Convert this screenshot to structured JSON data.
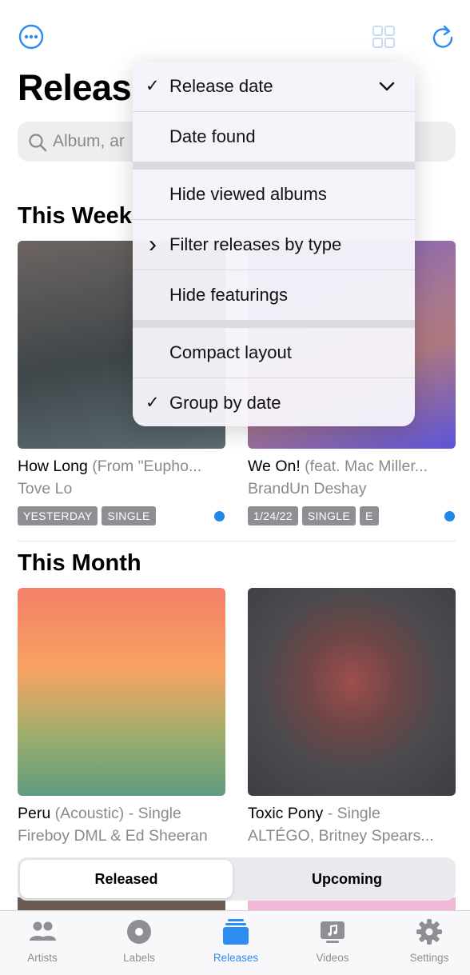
{
  "header": {
    "title": "Releas",
    "more_icon": "ellipsis-circle-icon",
    "grid_icon": "grid-icon",
    "refresh_icon": "refresh-icon"
  },
  "search": {
    "placeholder": "Album, ar"
  },
  "sections": [
    {
      "title": "This Week",
      "albums": [
        {
          "title": "How Long",
          "subtitle": " (From \"Eupho...",
          "artist": "Tove Lo",
          "badges": [
            "YESTERDAY",
            "SINGLE"
          ],
          "unviewed": true
        },
        {
          "title": "We On!",
          "subtitle": " (feat. Mac Miller...",
          "artist": "BrandUn Deshay",
          "badges": [
            "1/24/22",
            "SINGLE",
            "E"
          ],
          "unviewed": true
        }
      ]
    },
    {
      "title": "This Month",
      "albums": [
        {
          "title": "Peru",
          "subtitle": " (Acoustic) - Single",
          "artist": "Fireboy DML & Ed Sheeran"
        },
        {
          "title": "Toxic Pony",
          "subtitle": " - Single",
          "artist": "ALTÉGO, Britney Spears..."
        }
      ]
    }
  ],
  "menu": {
    "items": [
      {
        "label": "Release date",
        "lead": "✓",
        "trailing": "chevron-down-icon"
      },
      {
        "label": "Date found"
      },
      {
        "label": "Hide viewed albums"
      },
      {
        "label": "Filter releases by type",
        "lead": "›"
      },
      {
        "label": "Hide featurings"
      },
      {
        "label": "Compact layout"
      },
      {
        "label": "Group by date",
        "lead": "✓"
      }
    ]
  },
  "segmented": {
    "released": "Released",
    "upcoming": "Upcoming",
    "selected": "Released"
  },
  "tabbar": {
    "tabs": [
      {
        "label": "Artists",
        "icon": "people-icon"
      },
      {
        "label": "Labels",
        "icon": "record-icon"
      },
      {
        "label": "Releases",
        "icon": "stack-icon",
        "active": true
      },
      {
        "label": "Videos",
        "icon": "music-video-icon"
      },
      {
        "label": "Settings",
        "icon": "gear-icon"
      }
    ]
  },
  "colors": {
    "accent": "#2d8cf0",
    "badge": "#8e8e93",
    "dot": "#1e88e5"
  }
}
